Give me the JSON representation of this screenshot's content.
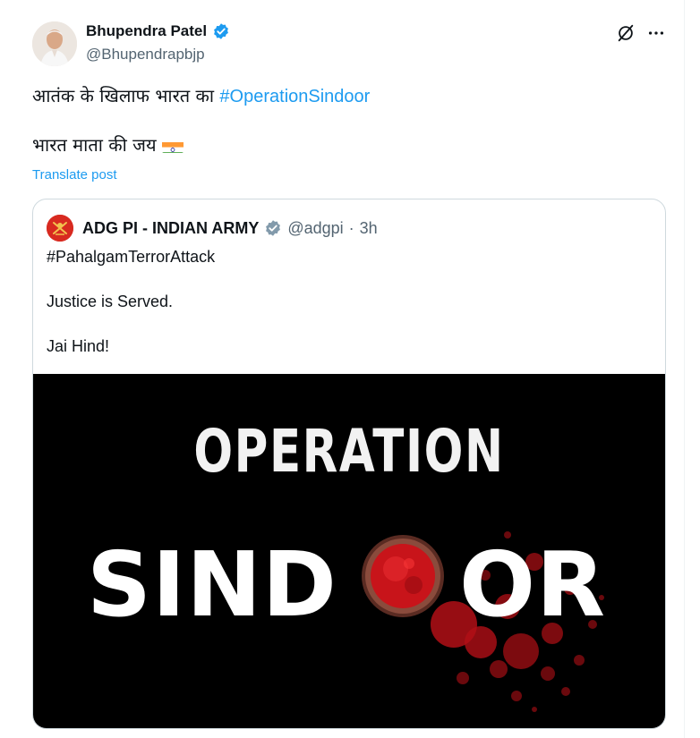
{
  "tweet": {
    "author": {
      "display_name": "Bhupendra Patel",
      "handle": "@Bhupendrapbjp",
      "verified_icon": "verified-badge-icon"
    },
    "text_line1_prefix": "आतंक के खिलाफ भारत का ",
    "text_line1_hashtag": "#OperationSindoor",
    "text_line2": "भारत माता की जय",
    "flag_icon": "india-flag-icon",
    "translate_label": "Translate post",
    "actions": {
      "grok_icon": "grok-icon",
      "more_icon": "more-icon"
    }
  },
  "quote": {
    "author": {
      "display_name": "ADG PI - INDIAN ARMY",
      "handle": "@adgpi",
      "separator": "·",
      "time": "3h"
    },
    "text": {
      "hashtag": "#PahalgamTerrorAttack",
      "line2": "Justice is Served.",
      "line3": "Jai Hind!"
    },
    "image": {
      "word_top": "OPERATION",
      "word_bottom_left": "SIND",
      "word_bottom_right": "OR"
    }
  },
  "colors": {
    "accent": "#1d9bf0",
    "text": "#0f1419",
    "muted": "#536471",
    "army_red": "#d82a20",
    "sindoor_red": "#c8141a"
  }
}
